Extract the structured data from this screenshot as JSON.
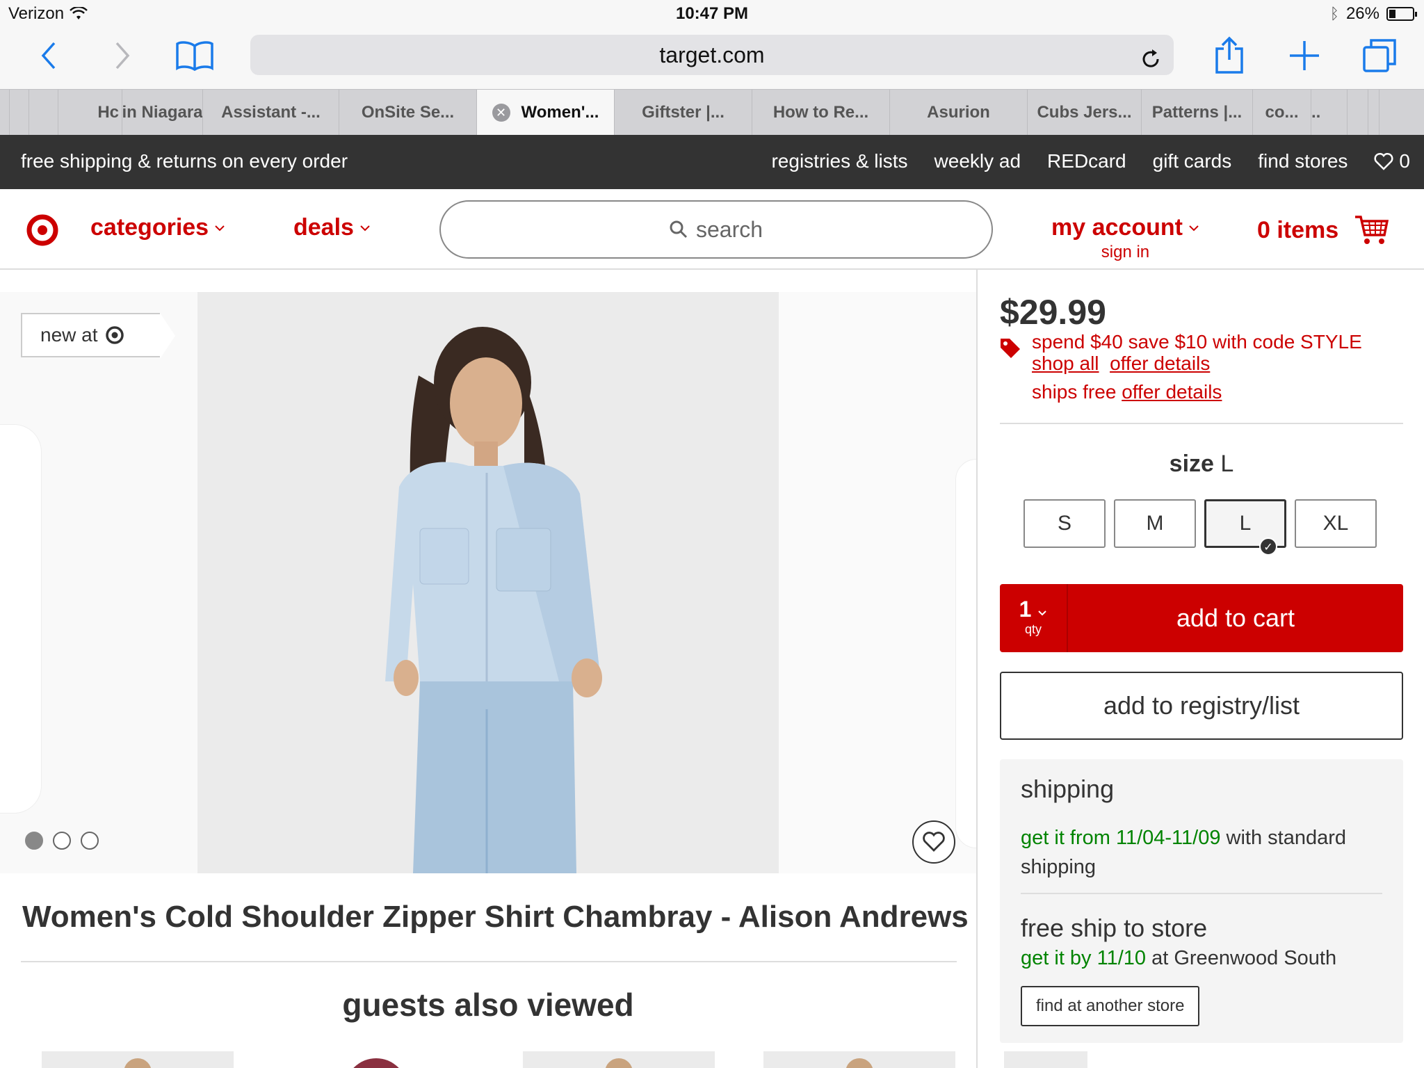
{
  "status_bar": {
    "carrier": "Verizon",
    "time": "10:47 PM",
    "battery": "26%"
  },
  "browser": {
    "url": "target.com",
    "tabs": [
      "Hc",
      "in Niagara",
      "Assistant -...",
      "OnSite Se...",
      "Women'...",
      "Giftster |...",
      "How to Re...",
      "Asurion",
      "Cubs Jers...",
      "Patterns |...",
      "co...",
      ".."
    ],
    "active_tab": 4
  },
  "promo_bar": {
    "text": "free shipping & returns on every order",
    "links": [
      "registries & lists",
      "weekly ad",
      "REDcard",
      "gift cards",
      "find stores"
    ],
    "favorites_count": "0"
  },
  "header": {
    "categories": "categories",
    "deals": "deals",
    "search_placeholder": "search",
    "account": "my account",
    "sign_in": "sign in",
    "cart": "0 items"
  },
  "product": {
    "badge": "new at",
    "title": "Women's Cold Shoulder Zipper Shirt Chambray - Alison Andrews",
    "image_count": 3,
    "current_image": 1,
    "price": "$29.99",
    "offer_text": "spend $40 save $10 with code STYLE",
    "shop_all": "shop all",
    "offer_details": "offer details",
    "ships_free": "ships free",
    "ships_offer_details": "offer details",
    "size_label": "size",
    "selected_size": "L",
    "sizes": [
      "S",
      "M",
      "L",
      "XL"
    ],
    "qty": "1",
    "qty_label": "qty",
    "add_to_cart": "add to cart",
    "add_to_registry": "add to registry/list"
  },
  "shipping": {
    "heading": "shipping",
    "standard_green": "get it from 11/04-11/09",
    "standard_rest": " with standard shipping",
    "store_heading": "free ship to store",
    "store_green": "get it by 11/10",
    "store_rest": " at Greenwood South",
    "find_store_button": "find at another store"
  },
  "also_viewed": {
    "heading": "guests also viewed"
  },
  "colors": {
    "brand_red": "#cc0000",
    "promo_bg": "#333333",
    "ship_green": "#008300"
  }
}
